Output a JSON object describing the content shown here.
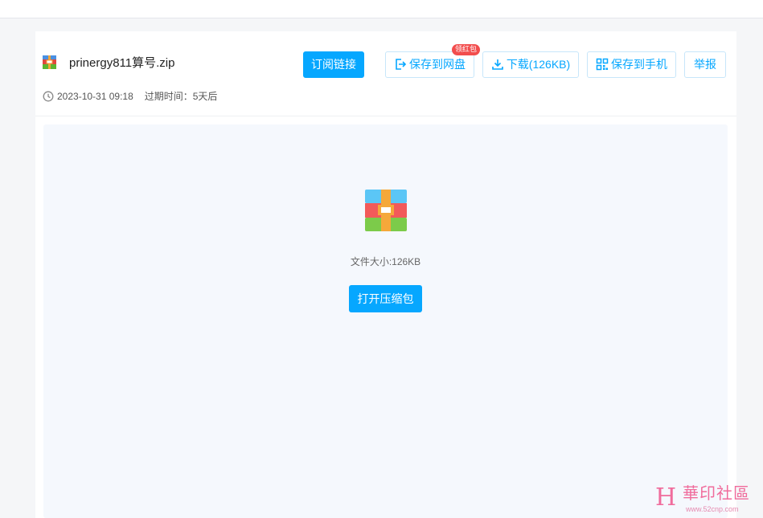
{
  "file": {
    "name": "prinergy811算号.zip",
    "date": "2023-10-31 09:18",
    "expire_label": "过期时间：5天后",
    "size_label": "文件大小:126KB"
  },
  "toolbar": {
    "subscribe_label": "订阅链接",
    "save_cloud_label": "保存到网盘",
    "save_cloud_badge": "领红包",
    "download_label": "下载(126KB)",
    "save_phone_label": "保存到手机",
    "report_label": "举报"
  },
  "preview": {
    "open_label": "打开压缩包"
  },
  "watermark": {
    "logo": "H",
    "title": "華印社區",
    "url": "www.52cnp.com"
  },
  "colors": {
    "accent": "#06a7ff",
    "badge": "#f24d4d"
  }
}
